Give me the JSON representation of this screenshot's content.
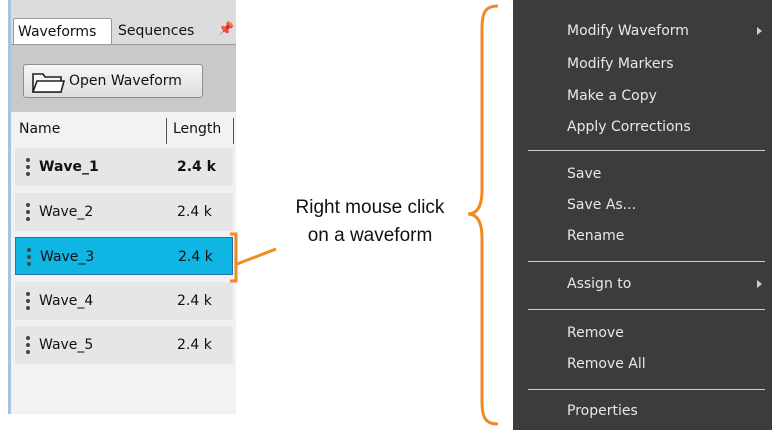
{
  "panel": {
    "tabs": [
      {
        "label": "Waveforms",
        "active": true
      },
      {
        "label": "Sequences",
        "active": false
      }
    ],
    "pin_icon": "pin-icon",
    "open_button": {
      "label": "Open Waveform",
      "icon": "folder-icon"
    },
    "columns": {
      "name": "Name",
      "length": "Length"
    },
    "waveforms": [
      {
        "name": "Wave_1",
        "length": "2.4 k",
        "bold": true,
        "selected": false
      },
      {
        "name": "Wave_2",
        "length": "2.4 k",
        "bold": false,
        "selected": false
      },
      {
        "name": "Wave_3",
        "length": "2.4 k",
        "bold": false,
        "selected": true
      },
      {
        "name": "Wave_4",
        "length": "2.4 k",
        "bold": false,
        "selected": false
      },
      {
        "name": "Wave_5",
        "length": "2.4 k",
        "bold": false,
        "selected": false
      }
    ],
    "selected_color": "#0fb6e3"
  },
  "annotation": {
    "line1": "Right mouse click",
    "line2": "on a waveform",
    "color": "#f08a24"
  },
  "context_menu": {
    "groups": [
      [
        {
          "label": "Modify Waveform",
          "submenu": true
        },
        {
          "label": "Modify Markers",
          "submenu": false
        },
        {
          "label": "Make a Copy",
          "submenu": false
        },
        {
          "label": "Apply Corrections",
          "submenu": false
        }
      ],
      [
        {
          "label": "Save",
          "submenu": false
        },
        {
          "label": "Save As...",
          "submenu": false
        },
        {
          "label": "Rename",
          "submenu": false
        }
      ],
      [
        {
          "label": "Assign to",
          "submenu": true
        }
      ],
      [
        {
          "label": "Remove",
          "submenu": false
        },
        {
          "label": "Remove All",
          "submenu": false
        }
      ],
      [
        {
          "label": "Properties",
          "submenu": false
        }
      ]
    ],
    "background": "#3c3c3c"
  }
}
